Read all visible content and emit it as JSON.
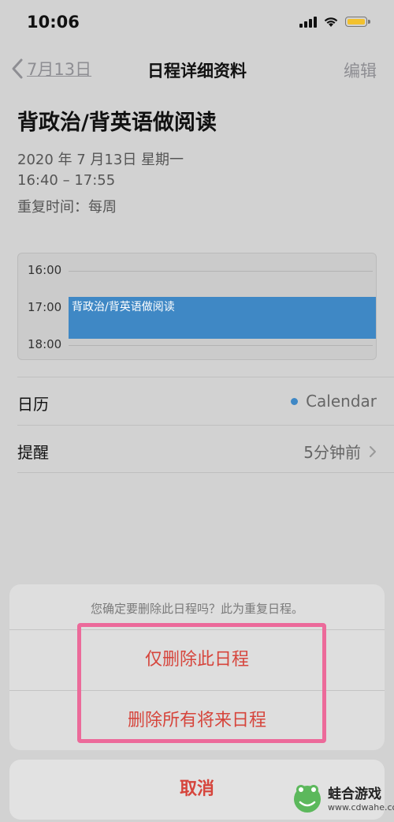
{
  "status_bar": {
    "time": "10:06"
  },
  "nav": {
    "back_label": "7月13日",
    "title": "日程详细资料",
    "edit_label": "编辑"
  },
  "event": {
    "title": "背政治/背英语做阅读",
    "date": "2020 年 7 月13日  星期一",
    "time_range": "16:40 – 17:55",
    "repeat": "重复时间：每周"
  },
  "timeline": {
    "labels": [
      "16:00",
      "17:00",
      "18:00"
    ],
    "event_label": "背政治/背英语做阅读",
    "event_color": "#3f88c5"
  },
  "details": {
    "calendar_label": "日历",
    "calendar_value": "Calendar",
    "alert_label": "提醒",
    "alert_value": "5分钟前"
  },
  "action_sheet": {
    "message": "您确定要删除此日程吗？此为重复日程。",
    "delete_this": "仅删除此日程",
    "delete_future": "删除所有将来日程",
    "cancel": "取消",
    "destructive_color": "#d6453c",
    "highlight_color": "#ec6a9a"
  },
  "watermark": {
    "name": "蛙合游戏",
    "url": "www.cdwahe.com"
  }
}
